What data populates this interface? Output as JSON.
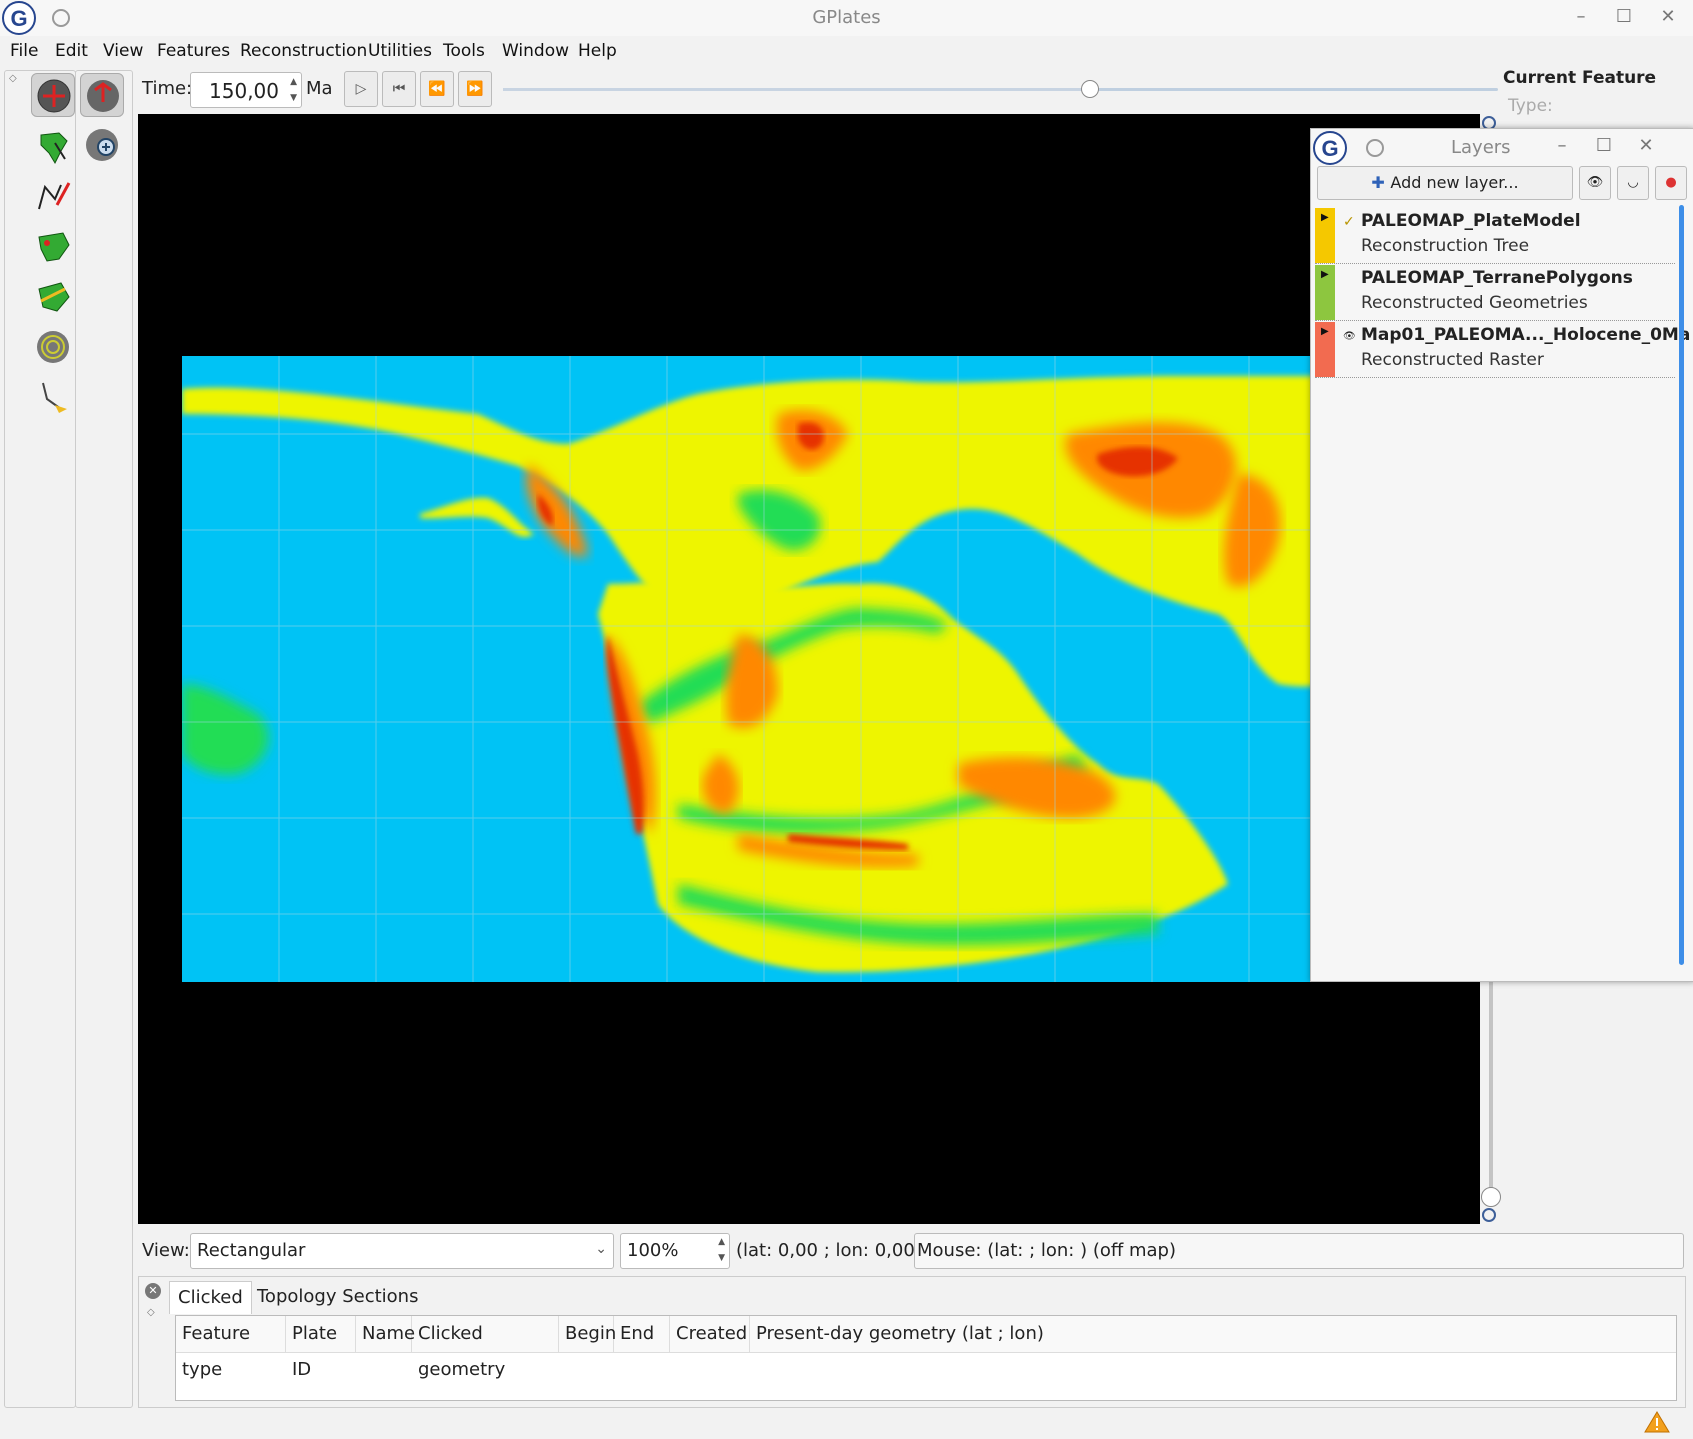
{
  "window": {
    "title": "GPlates"
  },
  "menu": [
    "File",
    "Edit",
    "View",
    "Features",
    "Reconstruction",
    "Utilities",
    "Tools",
    "Window",
    "Help"
  ],
  "tools": {
    "col1": [
      "drag-globe-icon",
      "choose-feature-icon",
      "digitise-geometry-icon",
      "build-topology-icon",
      "edit-topology-icon",
      "measure-distance-icon",
      "small-circle-icon"
    ],
    "col2": [
      "rotate-globe-icon",
      "zoom-icon"
    ]
  },
  "time": {
    "label": "Time:",
    "value": "150,00",
    "unit": "Ma",
    "slider_fraction": 0.59
  },
  "current_feature": {
    "title": "Current Feature",
    "type_label": "Type:"
  },
  "layers": {
    "title": "Layers",
    "add_label": "Add new layer...",
    "items": [
      {
        "name": "PALEOMAP_PlateModel",
        "type": "Reconstruction Tree",
        "color": "#f5c800",
        "mark": "✓"
      },
      {
        "name": "PALEOMAP_TerranePolygons",
        "type": "Reconstructed Geometries",
        "color": "#8dc63f",
        "mark": ""
      },
      {
        "name": "Map01_PALEOMA..._Holocene_0Ma",
        "type": "Reconstructed Raster",
        "color": "#f26b50",
        "mark": "👁"
      }
    ]
  },
  "viewbar": {
    "view_label": "View:",
    "projection": "Rectangular",
    "zoom": "100%",
    "camera": "(lat: 0,00 ; lon: 0,00)",
    "mouse": "Mouse: (lat:  ; lon: ) (off map)"
  },
  "bottom": {
    "tabs": [
      "Clicked",
      "Topology Sections"
    ],
    "columns": [
      "Feature type",
      "Plate ID",
      "Name",
      "Clicked geometry",
      "Begin",
      "End",
      "Created",
      "Present-day geometry (lat ; lon)"
    ]
  },
  "colors": {
    "ocean": "#00c3f5",
    "land": "#eef500",
    "high": "#ff8800",
    "peak": "#e63300",
    "lowland": "#22dd55"
  }
}
